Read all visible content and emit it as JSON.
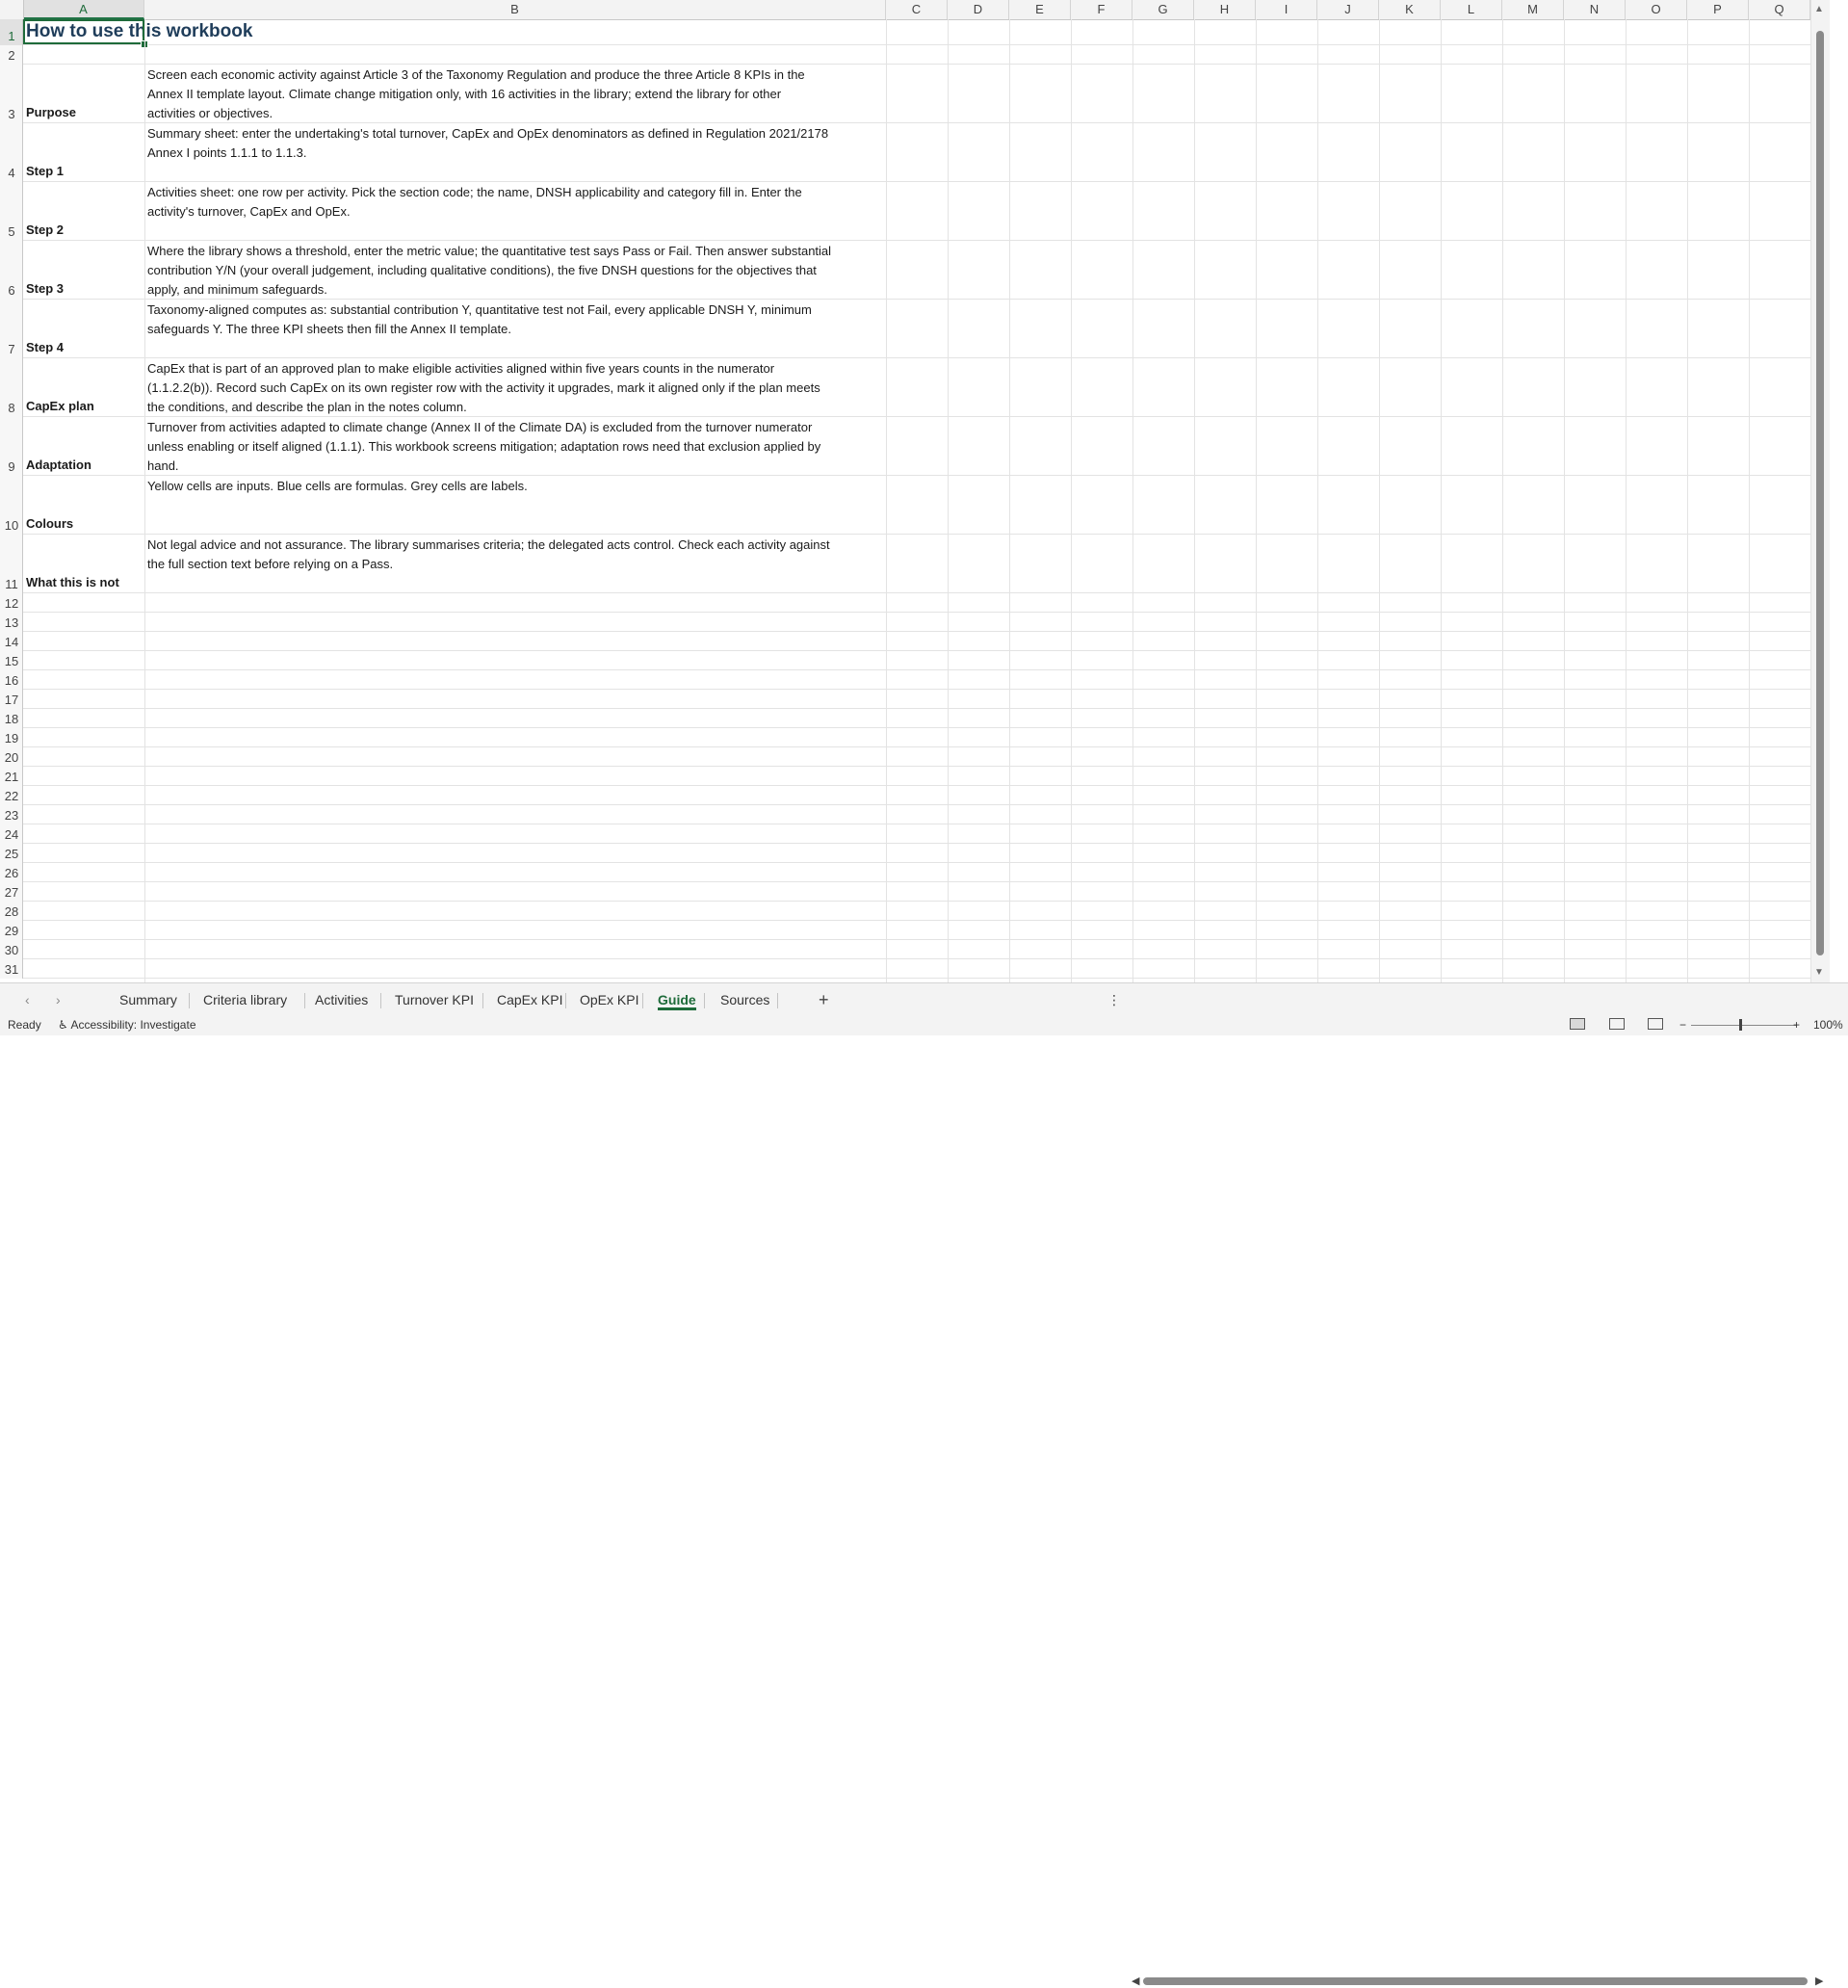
{
  "columns": [
    "A",
    "B",
    "C",
    "D",
    "E",
    "F",
    "G",
    "H",
    "I",
    "J",
    "K",
    "L",
    "M",
    "N",
    "O",
    "P",
    "Q"
  ],
  "selected_cell": {
    "column": "A",
    "row": "1"
  },
  "title": "How to use this workbook",
  "rows": [
    {
      "num": "1"
    },
    {
      "num": "2"
    },
    {
      "num": "3",
      "label": "Purpose",
      "text": [
        "Screen each economic activity against Article 3 of the Taxonomy Regulation and produce the three Article 8 KPIs in the",
        "Annex II template layout. Climate change mitigation only, with 16 activities in the library; extend the library for other",
        "activities or objectives."
      ]
    },
    {
      "num": "4",
      "label": "Step 1",
      "text": [
        "Summary sheet: enter the undertaking's total turnover, CapEx and OpEx denominators as defined in Regulation 2021/2178",
        "Annex I points 1.1.1 to 1.1.3."
      ]
    },
    {
      "num": "5",
      "label": "Step 2",
      "text": [
        "Activities sheet: one row per activity. Pick the section code; the name, DNSH applicability and category fill in. Enter the",
        "activity's turnover, CapEx and OpEx."
      ]
    },
    {
      "num": "6",
      "label": "Step 3",
      "text": [
        "Where the library shows a threshold, enter the metric value; the quantitative test says Pass or Fail. Then answer substantial",
        "contribution Y/N (your overall judgement, including qualitative conditions), the five DNSH questions for the objectives that",
        "apply, and minimum safeguards."
      ]
    },
    {
      "num": "7",
      "label": "Step 4",
      "text": [
        "Taxonomy-aligned computes as: substantial contribution Y, quantitative test not Fail, every applicable DNSH Y, minimum",
        "safeguards Y. The three KPI sheets then fill the Annex II template."
      ]
    },
    {
      "num": "8",
      "label": "CapEx plan",
      "text": [
        "CapEx that is part of an approved plan to make eligible activities aligned within five years counts in the numerator",
        "(1.1.2.2(b)). Record such CapEx on its own register row with the activity it upgrades, mark it aligned only if the plan meets",
        "the conditions, and describe the plan in the notes column."
      ]
    },
    {
      "num": "9",
      "label": "Adaptation",
      "text": [
        "Turnover from activities adapted to climate change (Annex II of the Climate DA) is excluded from the turnover numerator",
        "unless enabling or itself aligned (1.1.1). This workbook screens mitigation; adaptation rows need that exclusion applied by",
        "hand."
      ]
    },
    {
      "num": "10",
      "label": "Colours",
      "text": [
        "Yellow cells are inputs. Blue cells are formulas. Grey cells are labels."
      ]
    },
    {
      "num": "11",
      "label": "What this is not",
      "text": [
        "Not legal advice and not assurance. The library summarises criteria; the delegated acts control. Check each activity against",
        "the full section text before relying on a Pass."
      ]
    },
    {
      "num": "12"
    },
    {
      "num": "13"
    },
    {
      "num": "14"
    },
    {
      "num": "15"
    },
    {
      "num": "16"
    },
    {
      "num": "17"
    },
    {
      "num": "18"
    },
    {
      "num": "19"
    },
    {
      "num": "20"
    },
    {
      "num": "21"
    },
    {
      "num": "22"
    },
    {
      "num": "23"
    },
    {
      "num": "24"
    },
    {
      "num": "25"
    },
    {
      "num": "26"
    },
    {
      "num": "27"
    },
    {
      "num": "28"
    },
    {
      "num": "29"
    },
    {
      "num": "30"
    },
    {
      "num": "31"
    }
  ],
  "sheet_tabs": [
    "Summary",
    "Criteria library",
    "Activities",
    "Turnover KPI",
    "CapEx KPI",
    "OpEx KPI",
    "Guide",
    "Sources"
  ],
  "active_tab": "Guide",
  "tabbar": {
    "prev": "‹",
    "next": "›",
    "add": "+",
    "more": "⋮"
  },
  "scroll": {
    "left": "◀",
    "right": "▶",
    "up": "▲",
    "down": "▼"
  },
  "status": {
    "ready": "Ready",
    "accessibility": "Accessibility: Investigate",
    "zoom": "100%",
    "zoom_minus": "−",
    "zoom_plus": "+"
  },
  "icons": {
    "accessibility": "accessibility-icon",
    "normal_view": "normal-view-icon",
    "page_layout": "page-layout-icon",
    "page_break": "page-break-preview-icon"
  }
}
